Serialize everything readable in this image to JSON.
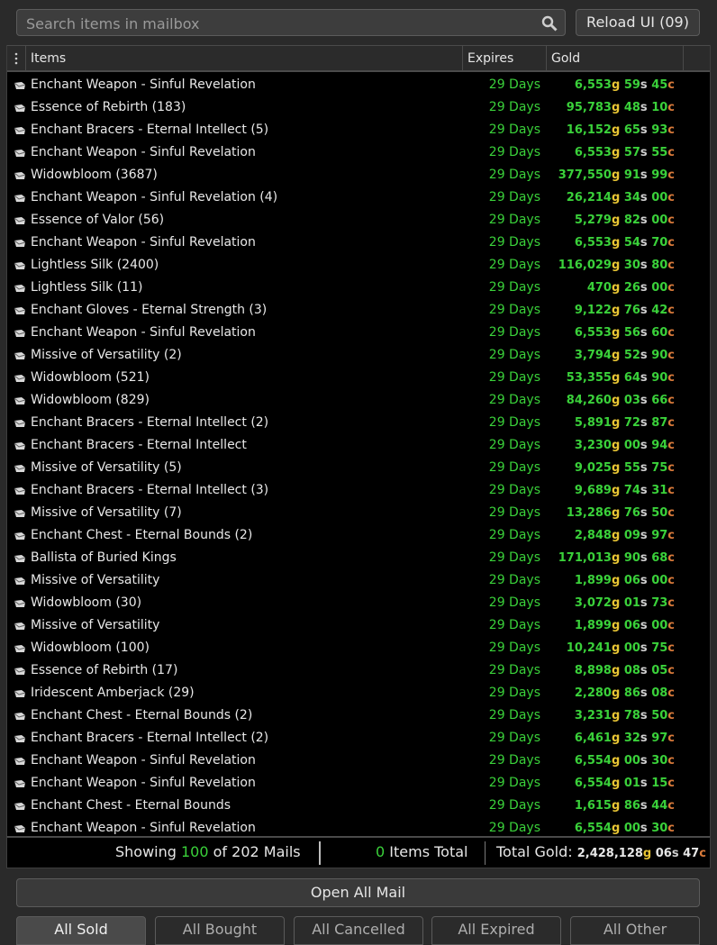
{
  "search": {
    "placeholder": "Search items in mailbox",
    "value": ""
  },
  "reload_label": "Reload UI (09)",
  "columns": {
    "items": "Items",
    "expires": "Expires",
    "gold": "Gold"
  },
  "rows": [
    {
      "name": "Enchant Weapon - Sinful Revelation",
      "expires": "29 Days",
      "g": "6,553",
      "s": "59",
      "c": "45"
    },
    {
      "name": "Essence of Rebirth (183)",
      "expires": "29 Days",
      "g": "95,783",
      "s": "48",
      "c": "10"
    },
    {
      "name": "Enchant Bracers - Eternal Intellect (5)",
      "expires": "29 Days",
      "g": "16,152",
      "s": "65",
      "c": "93"
    },
    {
      "name": "Enchant Weapon - Sinful Revelation",
      "expires": "29 Days",
      "g": "6,553",
      "s": "57",
      "c": "55"
    },
    {
      "name": "Widowbloom (3687)",
      "expires": "29 Days",
      "g": "377,550",
      "s": "91",
      "c": "99"
    },
    {
      "name": "Enchant Weapon - Sinful Revelation (4)",
      "expires": "29 Days",
      "g": "26,214",
      "s": "34",
      "c": "00"
    },
    {
      "name": "Essence of Valor (56)",
      "expires": "29 Days",
      "g": "5,279",
      "s": "82",
      "c": "00"
    },
    {
      "name": "Enchant Weapon - Sinful Revelation",
      "expires": "29 Days",
      "g": "6,553",
      "s": "54",
      "c": "70"
    },
    {
      "name": "Lightless Silk (2400)",
      "expires": "29 Days",
      "g": "116,029",
      "s": "30",
      "c": "80"
    },
    {
      "name": "Lightless Silk (11)",
      "expires": "29 Days",
      "g": "470",
      "s": "26",
      "c": "00"
    },
    {
      "name": "Enchant Gloves - Eternal Strength (3)",
      "expires": "29 Days",
      "g": "9,122",
      "s": "76",
      "c": "42"
    },
    {
      "name": "Enchant Weapon - Sinful Revelation",
      "expires": "29 Days",
      "g": "6,553",
      "s": "56",
      "c": "60"
    },
    {
      "name": "Missive of Versatility (2)",
      "expires": "29 Days",
      "g": "3,794",
      "s": "52",
      "c": "90"
    },
    {
      "name": "Widowbloom (521)",
      "expires": "29 Days",
      "g": "53,355",
      "s": "64",
      "c": "90"
    },
    {
      "name": "Widowbloom (829)",
      "expires": "29 Days",
      "g": "84,260",
      "s": "03",
      "c": "66"
    },
    {
      "name": "Enchant Bracers - Eternal Intellect (2)",
      "expires": "29 Days",
      "g": "5,891",
      "s": "72",
      "c": "87"
    },
    {
      "name": "Enchant Bracers - Eternal Intellect",
      "expires": "29 Days",
      "g": "3,230",
      "s": "00",
      "c": "94"
    },
    {
      "name": "Missive of Versatility (5)",
      "expires": "29 Days",
      "g": "9,025",
      "s": "55",
      "c": "75"
    },
    {
      "name": "Enchant Bracers - Eternal Intellect (3)",
      "expires": "29 Days",
      "g": "9,689",
      "s": "74",
      "c": "31"
    },
    {
      "name": "Missive of Versatility (7)",
      "expires": "29 Days",
      "g": "13,286",
      "s": "76",
      "c": "50"
    },
    {
      "name": "Enchant Chest - Eternal Bounds (2)",
      "expires": "29 Days",
      "g": "2,848",
      "s": "09",
      "c": "97"
    },
    {
      "name": "Ballista of Buried Kings",
      "expires": "29 Days",
      "g": "171,013",
      "s": "90",
      "c": "68"
    },
    {
      "name": "Missive of Versatility",
      "expires": "29 Days",
      "g": "1,899",
      "s": "06",
      "c": "00"
    },
    {
      "name": "Widowbloom (30)",
      "expires": "29 Days",
      "g": "3,072",
      "s": "01",
      "c": "73"
    },
    {
      "name": "Missive of Versatility",
      "expires": "29 Days",
      "g": "1,899",
      "s": "06",
      "c": "00"
    },
    {
      "name": "Widowbloom (100)",
      "expires": "29 Days",
      "g": "10,241",
      "s": "00",
      "c": "75"
    },
    {
      "name": "Essence of Rebirth (17)",
      "expires": "29 Days",
      "g": "8,898",
      "s": "08",
      "c": "05"
    },
    {
      "name": "Iridescent Amberjack (29)",
      "expires": "29 Days",
      "g": "2,280",
      "s": "86",
      "c": "08"
    },
    {
      "name": "Enchant Chest - Eternal Bounds (2)",
      "expires": "29 Days",
      "g": "3,231",
      "s": "78",
      "c": "50"
    },
    {
      "name": "Enchant Bracers - Eternal Intellect (2)",
      "expires": "29 Days",
      "g": "6,461",
      "s": "32",
      "c": "97"
    },
    {
      "name": "Enchant Weapon - Sinful Revelation",
      "expires": "29 Days",
      "g": "6,554",
      "s": "00",
      "c": "30"
    },
    {
      "name": "Enchant Weapon - Sinful Revelation",
      "expires": "29 Days",
      "g": "6,554",
      "s": "01",
      "c": "15"
    },
    {
      "name": "Enchant Chest - Eternal Bounds",
      "expires": "29 Days",
      "g": "1,615",
      "s": "86",
      "c": "44"
    },
    {
      "name": "Enchant Weapon - Sinful Revelation",
      "expires": "29 Days",
      "g": "6,554",
      "s": "00",
      "c": "30"
    }
  ],
  "currency_units": {
    "gold": "g",
    "silver": "s",
    "copper": "c"
  },
  "footer": {
    "showing_prefix": "Showing ",
    "showing_count": "100",
    "showing_suffix": " of 202 Mails",
    "items_count": "0",
    "items_label": " Items Total",
    "total_gold_label": "Total Gold: ",
    "total_g": "2,428,128",
    "total_s": "06",
    "total_c": "47"
  },
  "open_all_label": "Open All Mail",
  "tabs": [
    "All Sold",
    "All Bought",
    "All Cancelled",
    "All Expired",
    "All Other"
  ],
  "colors": {
    "value_green": "#3ad13a",
    "gold_unit": "#e8c534",
    "silver_unit": "#cfcfcf",
    "copper_unit": "#d97a3a"
  }
}
